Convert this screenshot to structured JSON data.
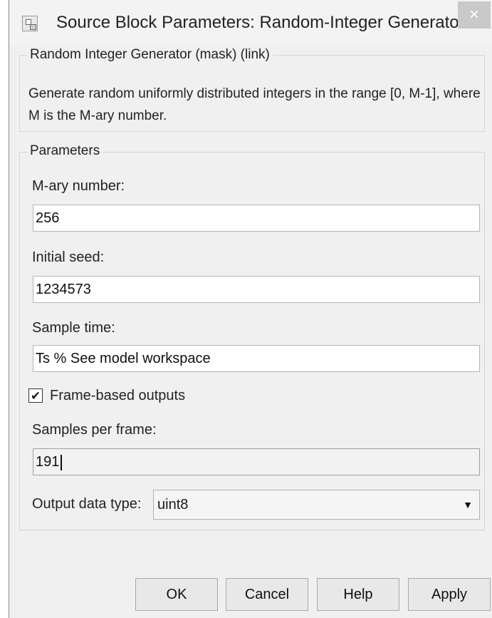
{
  "window": {
    "title": "Source Block Parameters: Random-Integer Generator",
    "close_glyph": "×"
  },
  "mask": {
    "legend": "Random Integer Generator (mask) (link)",
    "description": "Generate random uniformly distributed integers in the range [0, M-1], where M is the M-ary number."
  },
  "parameters": {
    "legend": "Parameters",
    "mary_label": "M-ary number:",
    "mary_value": "256",
    "seed_label": "Initial seed:",
    "seed_value": "1234573",
    "sample_time_label": "Sample time:",
    "sample_time_value": "Ts % See model workspace",
    "frame_based_label": "Frame-based outputs",
    "frame_based_checked": true,
    "check_glyph": "✔",
    "samples_per_frame_label": "Samples per frame:",
    "samples_per_frame_value": "191",
    "output_type_label": "Output data type:",
    "output_type_value": "uint8",
    "dropdown_glyph": "▼"
  },
  "buttons": {
    "ok": "OK",
    "cancel": "Cancel",
    "help": "Help",
    "apply": "Apply"
  }
}
